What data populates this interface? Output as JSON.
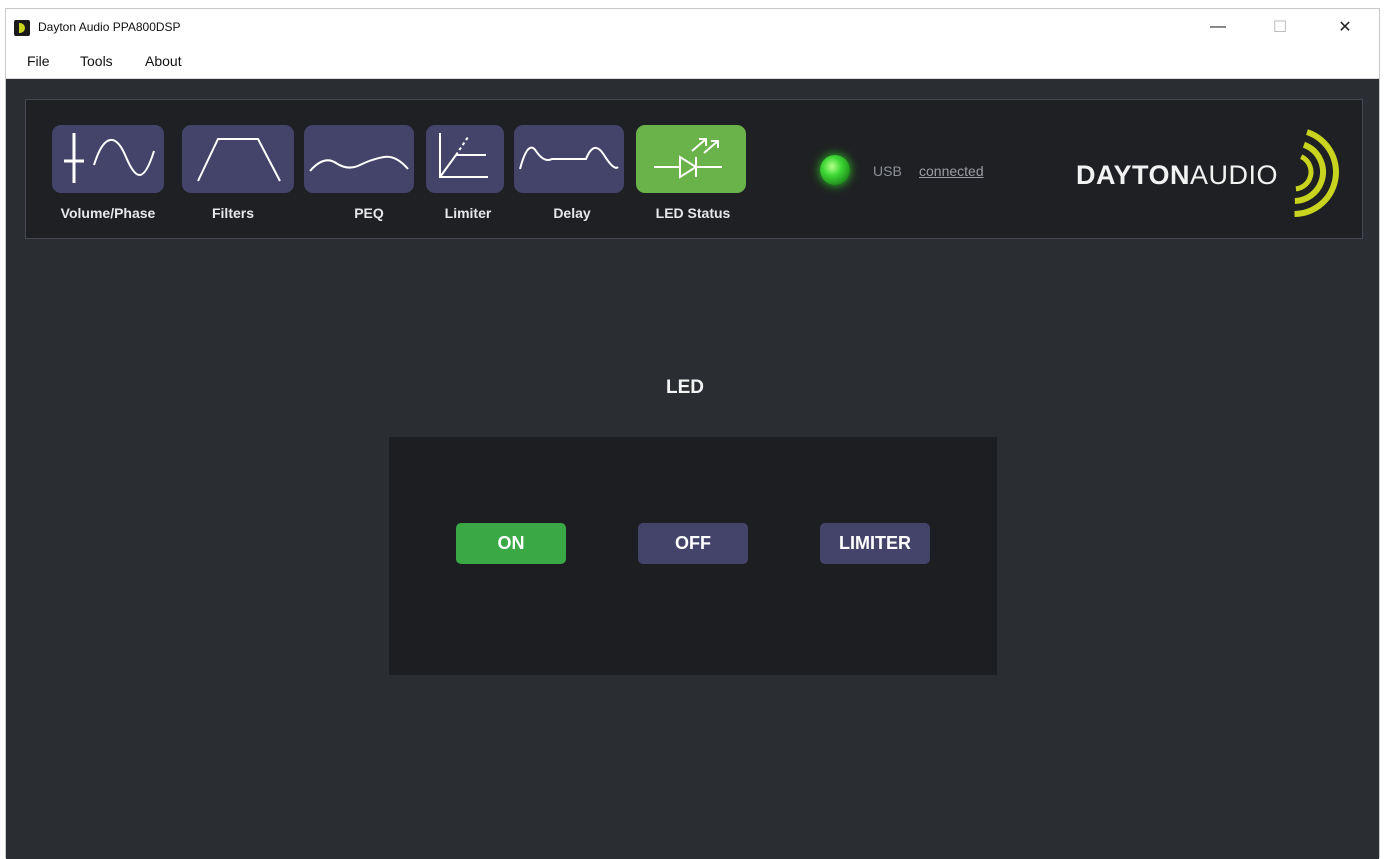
{
  "window": {
    "title": "Dayton Audio PPA800DSP",
    "controls": {
      "minimize": "—",
      "maximize": "☐",
      "close": "✕"
    }
  },
  "menu": [
    {
      "label": "File"
    },
    {
      "label": "Tools"
    },
    {
      "label": "About"
    }
  ],
  "toolbar": {
    "tools": [
      {
        "label": "Volume/Phase",
        "icon": "volume-phase-icon",
        "active": false
      },
      {
        "label": "Filters",
        "icon": "filters-icon",
        "active": false
      },
      {
        "label": "PEQ",
        "icon": "peq-icon",
        "active": false
      },
      {
        "label": "Limiter",
        "icon": "limiter-icon",
        "active": false
      },
      {
        "label": "Delay",
        "icon": "delay-icon",
        "active": false
      },
      {
        "label": "LED Status",
        "icon": "led-status-icon",
        "active": true
      }
    ],
    "usb": {
      "label": "USB",
      "status": "connected",
      "indicator_color": "#33cc2a"
    },
    "logo": {
      "text_bold": "DAYTON",
      "text_light": "AUDIO"
    }
  },
  "led_panel": {
    "title": "LED",
    "buttons": [
      {
        "label": "ON",
        "active": true
      },
      {
        "label": "OFF",
        "active": false
      },
      {
        "label": "LIMITER",
        "active": false
      }
    ]
  },
  "colors": {
    "background": "#2a2d31",
    "toolbar_bg": "#1f2023",
    "button_inactive": "#44446a",
    "button_active": "#6ab34a",
    "on_button": "#3aa845",
    "logo_accent": "#c8d41e"
  }
}
